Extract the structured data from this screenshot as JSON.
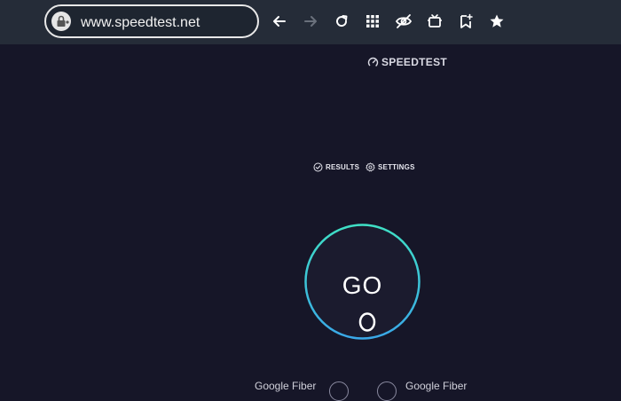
{
  "browser": {
    "url": "www.speedtest.net",
    "icons": [
      "lock-icon",
      "back-icon",
      "forward-icon",
      "reload-icon",
      "apps-grid-icon",
      "eye-off-icon",
      "tv-icon",
      "bookmark-add-icon",
      "star-icon"
    ]
  },
  "page": {
    "brand": "SPEEDTEST",
    "nav": {
      "results": "RESULTS",
      "settings": "SETTINGS"
    },
    "go_label": "GO",
    "servers": {
      "left": "Google Fiber",
      "right": "Google Fiber"
    },
    "colors": {
      "background": "#161628",
      "ring_start": "#3fe0c5",
      "ring_end": "#3aa8e8"
    }
  }
}
